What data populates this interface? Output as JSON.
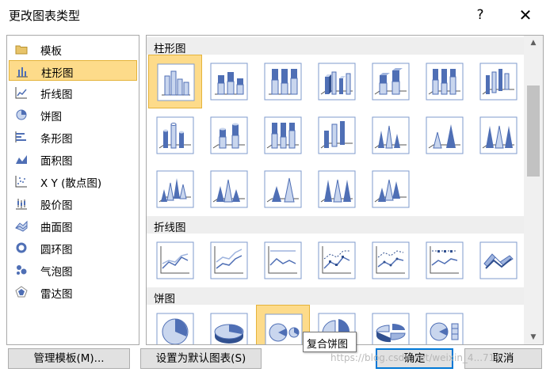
{
  "window": {
    "title": "更改图表类型",
    "help_glyph": "?",
    "close_glyph": "✕"
  },
  "sidebar": {
    "items": [
      {
        "label": "模板",
        "icon": "folder-icon"
      },
      {
        "label": "柱形图",
        "icon": "column-chart-icon",
        "selected": true
      },
      {
        "label": "折线图",
        "icon": "line-chart-icon"
      },
      {
        "label": "饼图",
        "icon": "pie-chart-icon"
      },
      {
        "label": "条形图",
        "icon": "bar-chart-icon"
      },
      {
        "label": "面积图",
        "icon": "area-chart-icon"
      },
      {
        "label": "X Y (散点图)",
        "icon": "scatter-chart-icon"
      },
      {
        "label": "股价图",
        "icon": "stock-chart-icon"
      },
      {
        "label": "曲面图",
        "icon": "surface-chart-icon"
      },
      {
        "label": "圆环图",
        "icon": "doughnut-chart-icon"
      },
      {
        "label": "气泡图",
        "icon": "bubble-chart-icon"
      },
      {
        "label": "雷达图",
        "icon": "radar-chart-icon"
      }
    ]
  },
  "gallery": {
    "groups": [
      {
        "name": "柱形图"
      },
      {
        "name": "折线图"
      },
      {
        "name": "饼图"
      }
    ],
    "tooltip": "复合饼图"
  },
  "buttons": {
    "manage_templates": "管理模板(M)...",
    "set_default": "设置为默认图表(S)",
    "ok": "确定",
    "cancel": "取消"
  },
  "watermark": "https://blog.csdn.net/weixin_4...714",
  "colors": {
    "selection_fill": "#fddb8a",
    "selection_border": "#e5b33a",
    "chart_blue": "#4f6fb5",
    "chart_light": "#c9d6ee",
    "primary_border": "#0078d7"
  }
}
